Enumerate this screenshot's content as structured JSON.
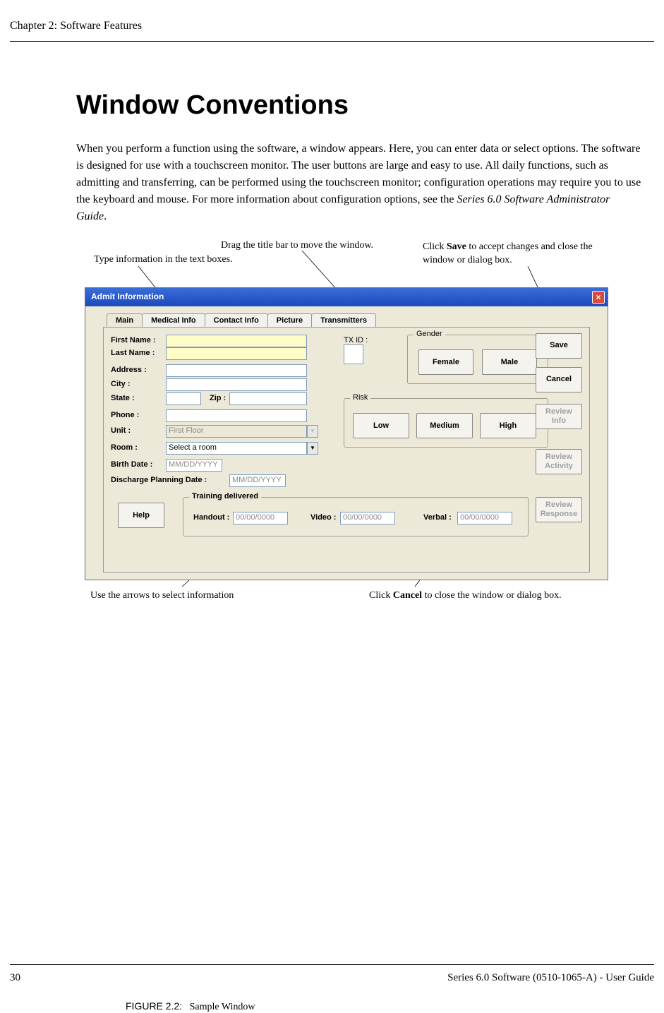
{
  "header": {
    "chapter_label": "Chapter 2: Software Features"
  },
  "title": "Window Conventions",
  "intro": {
    "text_pre": "When you perform a function using the software, a window appears. Here, you can enter data or select options. The software is designed for use with a touchscreen monitor. The user buttons are large and easy to use. All daily functions, such as admitting and transferring, can be performed using the touchscreen monitor; configuration operations may require you to use the keyboard and mouse. For more information about configuration options, see the ",
    "text_italic": "Series 6.0 Software Administrator Guide",
    "text_post": "."
  },
  "callouts": {
    "top_left": "Type information in the text boxes.",
    "top_mid": "Drag the title bar to move the window.",
    "top_right_pre": "Click ",
    "top_right_bold": "Save",
    "top_right_post": " to accept changes and close the window or dialog box.",
    "bottom_left": "Use the arrows to select information",
    "bottom_right_pre": "Click ",
    "bottom_right_bold": "Cancel",
    "bottom_right_post": " to close the window or dialog box."
  },
  "dialog": {
    "title": "Admit Information",
    "close_glyph": "×",
    "tabs": [
      "Main",
      "Medical Info",
      "Contact Info",
      "Picture",
      "Transmitters"
    ],
    "labels": {
      "first_name": "First Name :",
      "last_name": "Last Name :",
      "address": "Address :",
      "city": "City :",
      "state": "State :",
      "zip": "Zip :",
      "phone": "Phone :",
      "unit": "Unit :",
      "room": "Room :",
      "birth_date": "Birth Date :",
      "discharge": "Discharge Planning Date :",
      "txid": "TX ID :",
      "gender": "Gender",
      "risk": "Risk",
      "training": "Training delivered",
      "handout": "Handout :",
      "video": "Video :",
      "verbal": "Verbal :"
    },
    "values": {
      "unit": "First Floor",
      "room": "Select a room",
      "birth_date": "MM/DD/YYYY",
      "discharge": "MM/DD/YYYY",
      "handout": "00/00/0000",
      "video": "00/00/0000",
      "verbal": "00/00/0000"
    },
    "buttons": {
      "female": "Female",
      "male": "Male",
      "low": "Low",
      "medium": "Medium",
      "high": "High",
      "help": "Help",
      "save": "Save",
      "cancel": "Cancel",
      "review_info": "Review\nInfo",
      "review_activity": "Review\nActivity",
      "review_response": "Review\nResponse"
    }
  },
  "figure": {
    "label": "FIGURE 2.2:",
    "caption": "Sample Window"
  },
  "footer": {
    "page_no": "30",
    "doc_id": "Series 6.0 Software (0510-1065-A) - User Guide"
  }
}
